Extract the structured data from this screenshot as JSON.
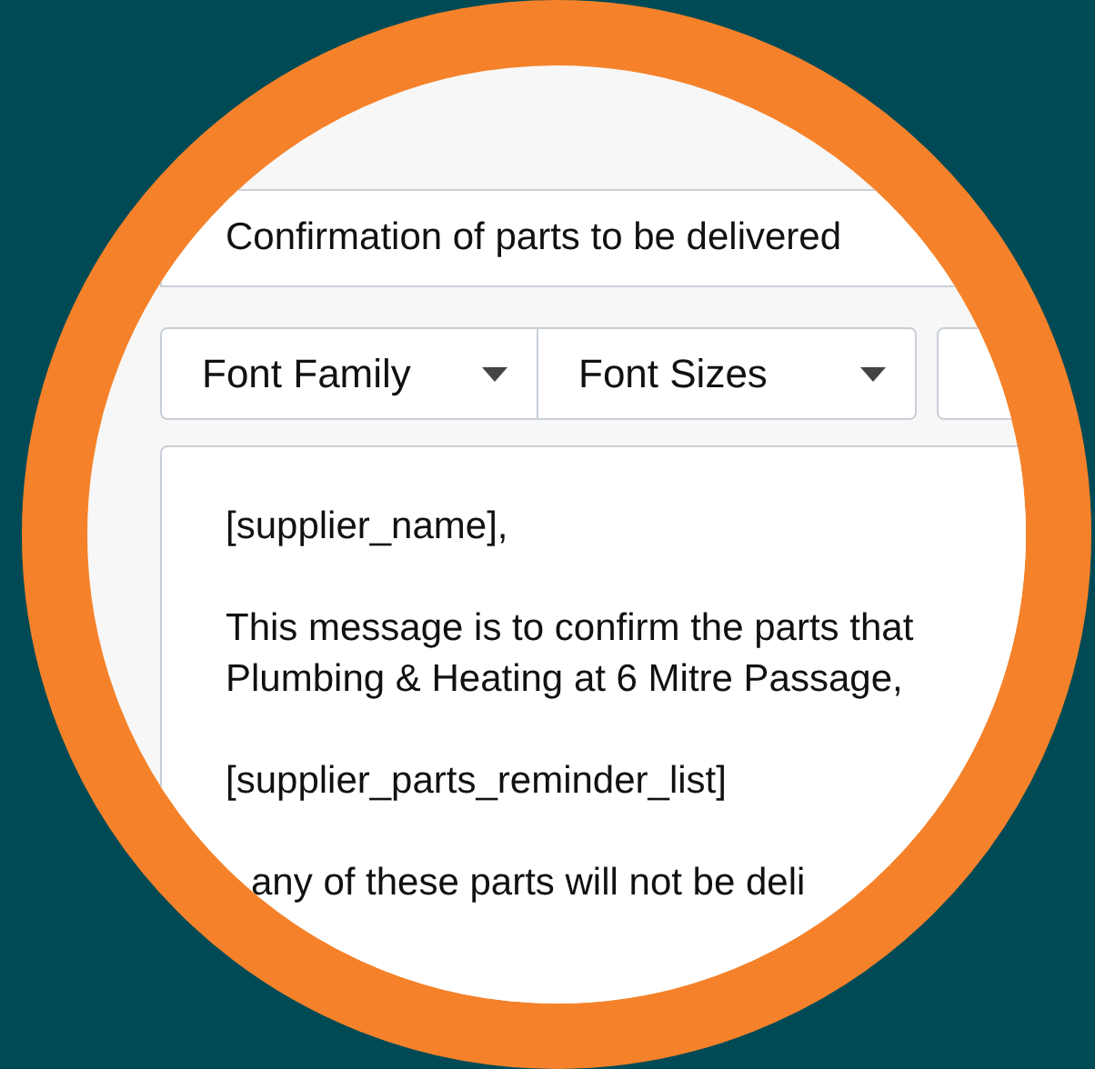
{
  "subject": {
    "value": "Confirmation of parts to be delivered"
  },
  "toolbar": [
    {
      "label": "Font Family",
      "kind": "dropdown"
    },
    {
      "label": "Font Sizes",
      "kind": "dropdown"
    },
    {
      "kind": "button"
    }
  ],
  "body": [
    "[supplier_name],",
    "This message is to confirm the parts that\nPlumbing & Heating at 6 Mitre Passage,",
    "[supplier_parts_reminder_list]",
    "any of these parts will not be deli"
  ]
}
